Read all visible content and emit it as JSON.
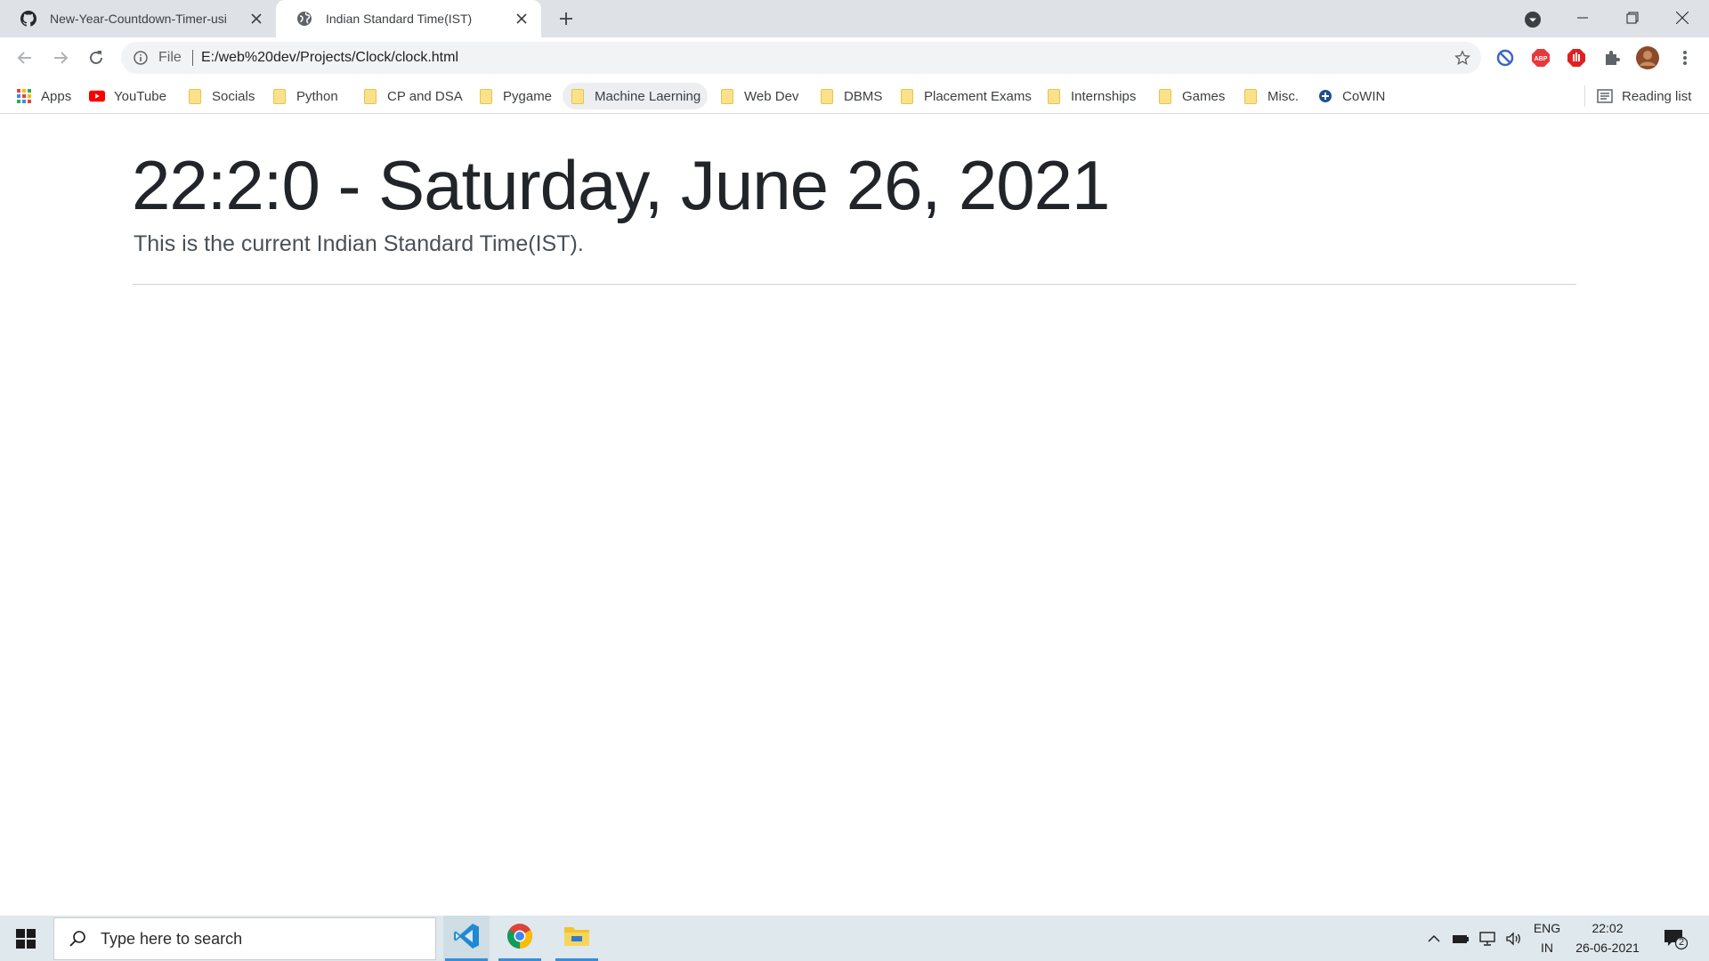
{
  "browser": {
    "tabs": [
      {
        "title": "New-Year-Countdown-Timer-usi",
        "favicon": "github-icon",
        "active": false
      },
      {
        "title": "Indian Standard Time(IST)",
        "favicon": "globe-icon",
        "active": true
      }
    ],
    "address": {
      "scheme_label": "File",
      "url": "E:/web%20dev/Projects/Clock/clock.html"
    },
    "bookmarks": [
      {
        "label": "Apps",
        "icon": "apps-grid-icon"
      },
      {
        "label": "YouTube",
        "icon": "youtube-icon"
      },
      {
        "label": "Socials",
        "icon": "folder-icon"
      },
      {
        "label": "Python",
        "icon": "folder-icon"
      },
      {
        "label": "CP and DSA",
        "icon": "folder-icon"
      },
      {
        "label": "Pygame",
        "icon": "folder-icon"
      },
      {
        "label": "Machine Laerning",
        "icon": "folder-icon"
      },
      {
        "label": "Web Dev",
        "icon": "folder-icon"
      },
      {
        "label": "DBMS",
        "icon": "folder-icon"
      },
      {
        "label": "Placement Exams",
        "icon": "folder-icon"
      },
      {
        "label": "Internships",
        "icon": "folder-icon"
      },
      {
        "label": "Games",
        "icon": "folder-icon"
      },
      {
        "label": "Misc.",
        "icon": "folder-icon"
      },
      {
        "label": "CoWIN",
        "icon": "cowin-icon"
      }
    ],
    "reading_list": "Reading list",
    "extensions": [
      {
        "name": "blocker-icon",
        "color": "#3c66c4"
      },
      {
        "name": "adblock-plus-icon",
        "label": "ABP",
        "color": "#e8383d"
      },
      {
        "name": "hand-stop-icon",
        "color": "#e02020"
      },
      {
        "name": "puzzle-icon",
        "color": "#5f6368"
      },
      {
        "name": "profile-avatar-icon",
        "color": "#8a4b2a"
      }
    ]
  },
  "page": {
    "clock_text": "22:2:0 - Saturday, June 26, 2021",
    "lead_text": "This is the current Indian Standard Time(IST)."
  },
  "taskbar": {
    "search_placeholder": "Type here to search",
    "apps": [
      {
        "name": "vscode-icon",
        "color": "#1f8ad2"
      },
      {
        "name": "chrome-icon",
        "color": "#db4437"
      },
      {
        "name": "file-explorer-icon",
        "color": "#f2c230"
      }
    ],
    "tray": {
      "lang_top": "ENG",
      "lang_bottom": "IN",
      "time": "22:02",
      "date": "26-06-2021",
      "notifications": "2"
    }
  }
}
